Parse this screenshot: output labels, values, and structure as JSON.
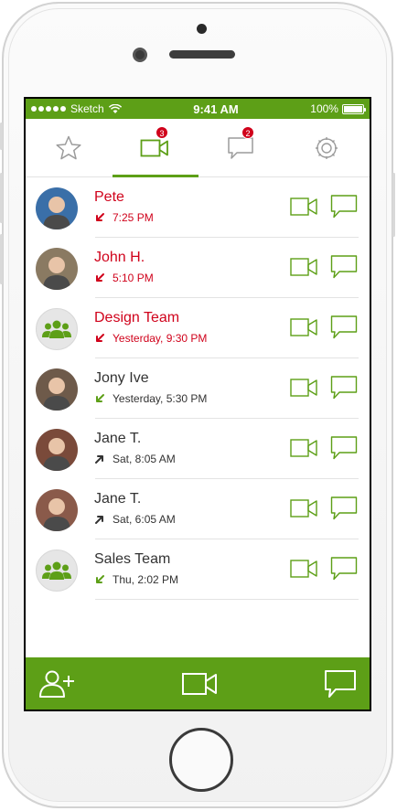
{
  "status_bar": {
    "carrier": "Sketch",
    "time": "9:41 AM",
    "battery": "100%"
  },
  "tabs": [
    {
      "name": "favorites",
      "icon": "star-icon",
      "badge": ""
    },
    {
      "name": "calls",
      "icon": "video-camera-icon",
      "badge": "3"
    },
    {
      "name": "messages",
      "icon": "chat-bubble-icon",
      "badge": "2"
    },
    {
      "name": "settings",
      "icon": "gear-icon",
      "badge": ""
    }
  ],
  "active_tab": "calls",
  "calls": [
    {
      "name": "Pete",
      "time": "7:25 PM",
      "direction": "incoming",
      "missed": true,
      "avatar": "person-avatar"
    },
    {
      "name": "John H.",
      "time": "5:10 PM",
      "direction": "incoming",
      "missed": true,
      "avatar": "person-avatar"
    },
    {
      "name": "Design Team",
      "time": "Yesterday, 9:30 PM",
      "direction": "incoming",
      "missed": true,
      "avatar": "group-icon"
    },
    {
      "name": "Jony Ive",
      "time": "Yesterday, 5:30 PM",
      "direction": "incoming",
      "missed": false,
      "avatar": "person-avatar"
    },
    {
      "name": "Jane T.",
      "time": "Sat, 8:05 AM",
      "direction": "outgoing",
      "missed": false,
      "avatar": "person-avatar"
    },
    {
      "name": "Jane T.",
      "time": "Sat, 6:05 AM",
      "direction": "outgoing",
      "missed": false,
      "avatar": "person-avatar"
    },
    {
      "name": "Sales Team",
      "time": "Thu, 2:02 PM",
      "direction": "incoming",
      "missed": false,
      "avatar": "group-icon"
    }
  ],
  "bottom_bar": [
    "add-contact-icon",
    "video-camera-icon",
    "chat-bubble-icon"
  ],
  "colors": {
    "accent": "#5d9f17",
    "missed": "#d0021b",
    "text": "#333333",
    "divider": "#e3e3e3",
    "inactive_icon": "#9b9b9b"
  }
}
